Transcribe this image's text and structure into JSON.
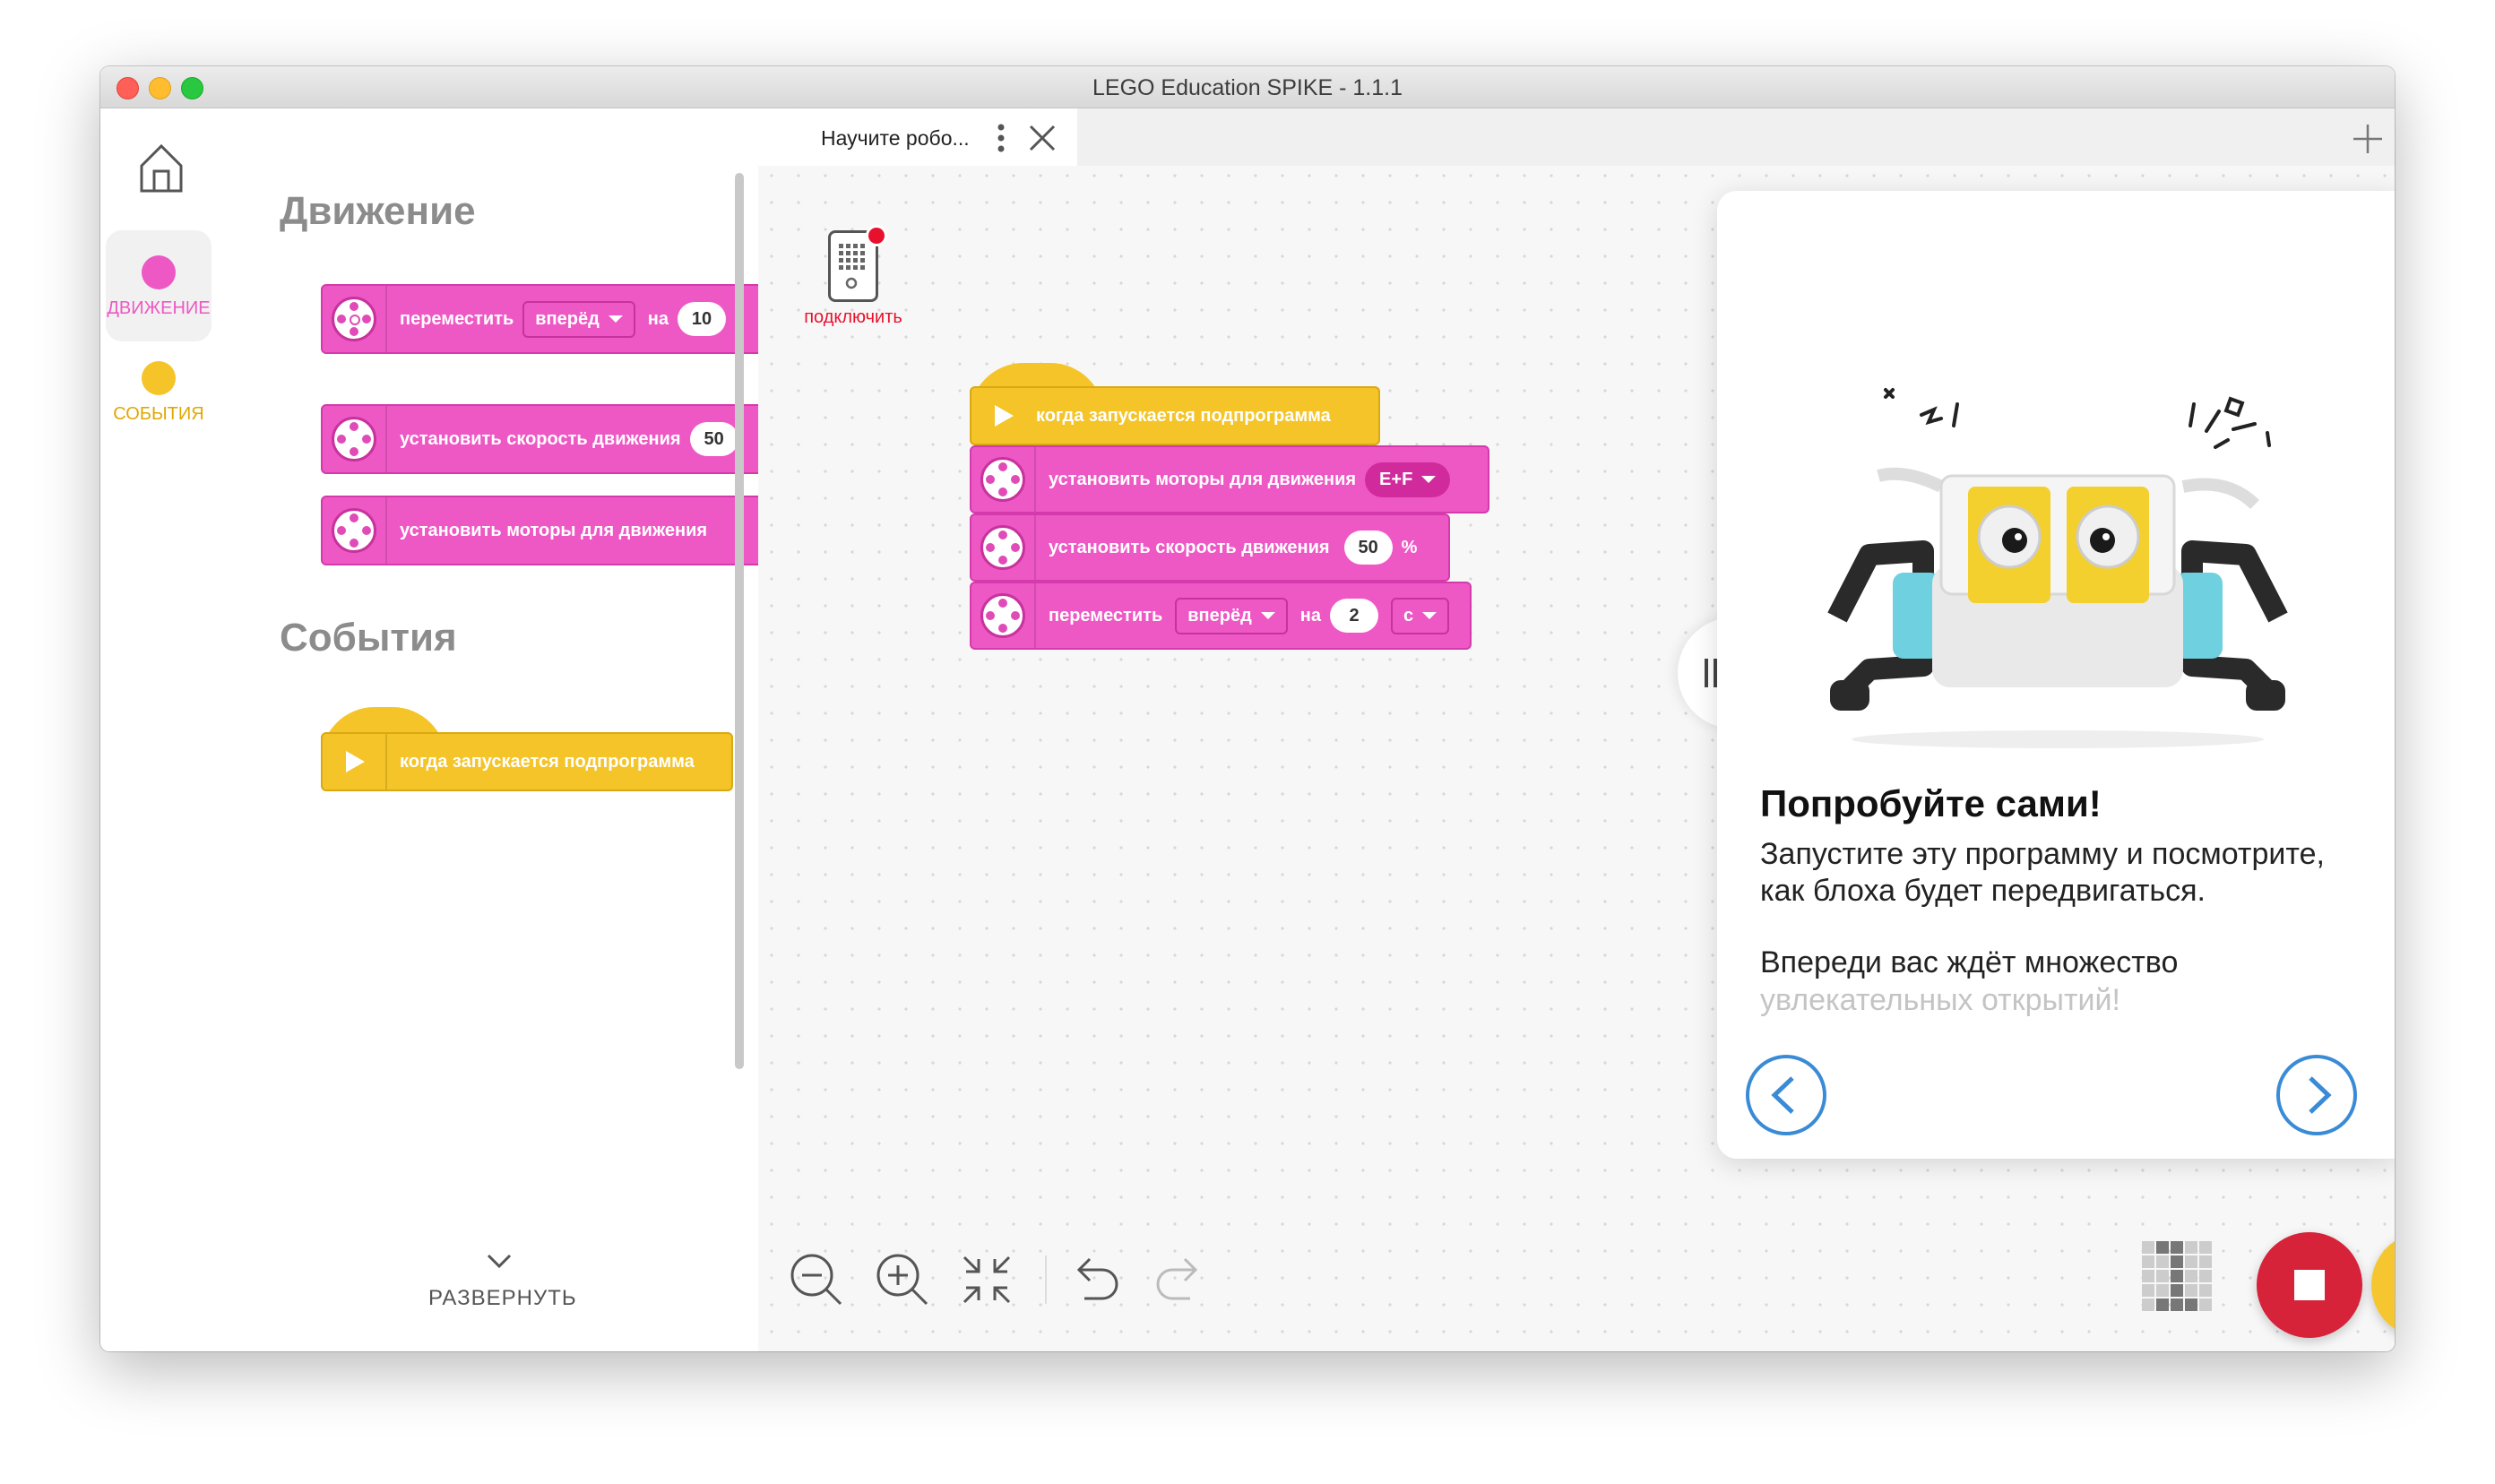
{
  "window": {
    "title": "LEGO Education SPIKE - 1.1.1"
  },
  "rail": {
    "categories": [
      {
        "label": "ДВИЖЕНИЕ",
        "color": "#ee58c4"
      },
      {
        "label": "СОБЫТИЯ",
        "color": "#f5c428"
      }
    ],
    "expand_label": "РАЗВЕРНУТЬ"
  },
  "palette": {
    "movement_title": "Движение",
    "events_title": "События",
    "blocks": [
      {
        "label": "переместить",
        "dropdown": "вперёд",
        "on": "на",
        "value": "10"
      },
      {
        "label": "установить скорость движения",
        "value": "50"
      },
      {
        "label": "установить моторы для движения"
      },
      {
        "label": "когда запускается подпрограмма"
      }
    ]
  },
  "tab": {
    "title": "Научите робо..."
  },
  "hub": {
    "connect_label": "подключить"
  },
  "program": {
    "hat": "когда запускается подпрограмма",
    "set_motors": {
      "label": "установить моторы для движения",
      "ports": "E+F"
    },
    "set_speed": {
      "label": "установить скорость движения",
      "value": "50",
      "unit": "%"
    },
    "move": {
      "label": "переместить",
      "direction": "вперёд",
      "on": "на",
      "value": "2",
      "unit": "с"
    }
  },
  "tutorial": {
    "heading": "Попробуйте сами!",
    "para1": "Запустите эту программу и посмотрите, как блоха будет передвигаться.",
    "para2_line1": "Впереди вас ждёт множество",
    "para2_line2": "увлекательных открытий!"
  },
  "colors": {
    "movement": "#ee58c4",
    "events": "#f5c428",
    "stop": "#d6233a",
    "run": "#f6c630",
    "link": "#3a8bd6"
  }
}
